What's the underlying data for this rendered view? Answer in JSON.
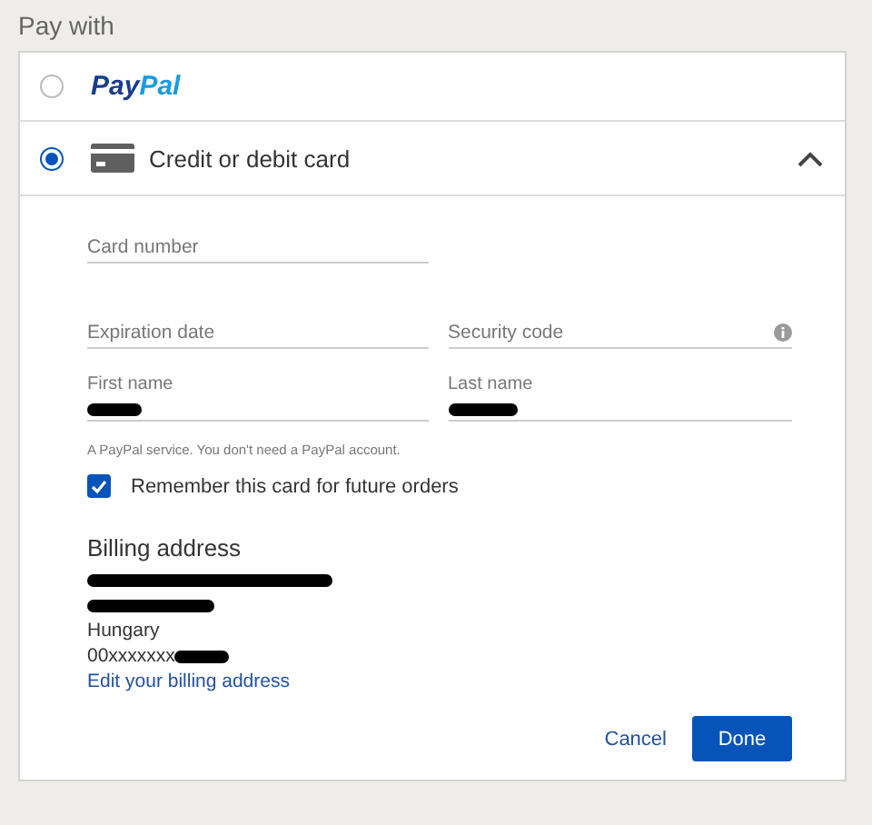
{
  "heading": "Pay with",
  "payment_methods": [
    {
      "kind": "paypal",
      "label": [
        "Pay",
        "Pal"
      ],
      "selected": false
    },
    {
      "kind": "card",
      "label": "Credit or debit card",
      "selected": true,
      "expanded": true
    }
  ],
  "card_form": {
    "rows": [
      [
        {
          "placeholder": "Card number",
          "redacted": false
        }
      ],
      [
        {
          "placeholder": "Expiration date",
          "redacted": false
        },
        {
          "placeholder": "Security code",
          "redacted": false,
          "info": true
        }
      ],
      [
        {
          "label": "First name",
          "redacted": true
        },
        {
          "label": "Last name",
          "redacted": true
        }
      ]
    ],
    "note": "A PayPal service. You don't need a PayPal account.",
    "remember": {
      "label": "Remember this card for future orders",
      "checked": true
    },
    "billing": {
      "title": "Billing address",
      "lines": [
        {
          "redacted": true
        },
        {
          "redacted": true
        },
        {
          "text": "Hungary",
          "redacted": false
        },
        {
          "text": "00xxxxxxx",
          "redacted": true
        }
      ],
      "edit_link": "Edit your billing address"
    },
    "buttons": [
      {
        "kind": "link",
        "label": "Cancel"
      },
      {
        "kind": "primary",
        "label": "Done"
      }
    ]
  }
}
